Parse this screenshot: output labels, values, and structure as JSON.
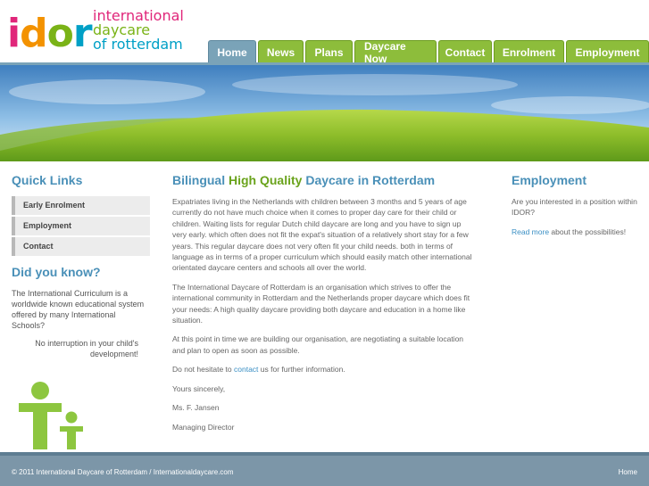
{
  "logo": {
    "mark": {
      "i": "i",
      "d": "d",
      "o": "o",
      "r": "r"
    },
    "line1": "international",
    "line2": "daycare",
    "line3": "of rotterdam"
  },
  "nav": {
    "tabs": [
      {
        "label": "Home",
        "active": true
      },
      {
        "label": "News",
        "active": false
      },
      {
        "label": "Plans",
        "active": false
      },
      {
        "label": "Daycare Now",
        "active": false
      },
      {
        "label": "Contact",
        "active": false
      },
      {
        "label": "Enrolment",
        "active": false
      },
      {
        "label": "Employment",
        "active": false
      }
    ]
  },
  "left": {
    "quick_links_title": "Quick Links",
    "quick_links": [
      "Early Enrolment",
      "Employment",
      "Contact"
    ],
    "did_you_know_title": "Did you know?",
    "did_you_know_text": "The International Curriculum is a worldwide known educational system offered by many International Schools?",
    "did_you_know_note": "No interruption in your child's development!"
  },
  "main": {
    "title_pre": "Bilingual ",
    "title_highlight": "High Quality",
    "title_post": " Daycare in Rotterdam",
    "p1": "Expatriates living in the Netherlands with children between 3 months and 5 years of age currently do not have much choice when it comes to proper day care for their child or children. Waiting lists for regular Dutch child daycare are long and you have to sign up very early. which often does not fit the expat's situation of a relatively short stay for a few years. This regular daycare does not very often fit your child needs. both in terms of language as in terms of a proper curriculum which should easily match other international orientated daycare centers and schools all over the world.",
    "p2": "The International Daycare of Rotterdam is an organisation which strives to offer the international community in Rotterdam and the Netherlands proper daycare which does fit your needs: A high quality daycare providing both daycare and education in a home like situation.",
    "p3": "At this point in time we are building our organisation, are negotiating a suitable location and plan to open as soon as possible.",
    "p4_pre": "Do not hesitate to ",
    "p4_link": "contact",
    "p4_post": " us for further information.",
    "closing": "Yours sincerely,",
    "name": "Ms. F. Jansen",
    "role": "Managing Director"
  },
  "right": {
    "title": "Employment",
    "text": "Are you interested in a position within IDOR?",
    "link": "Read more",
    "link_post": " about the possibilities!"
  },
  "footer": {
    "copyright": "© 2011 International Daycare of Rotterdam / Internationaldaycare.com",
    "home": "Home"
  },
  "colors": {
    "nav_green": "#8dbd3b",
    "nav_active": "#7aa3b8",
    "heading_blue": "#4a90b8",
    "heading_green": "#6aa31c",
    "figure_green": "#8dc63f",
    "footer_bg": "#7c96a8"
  }
}
